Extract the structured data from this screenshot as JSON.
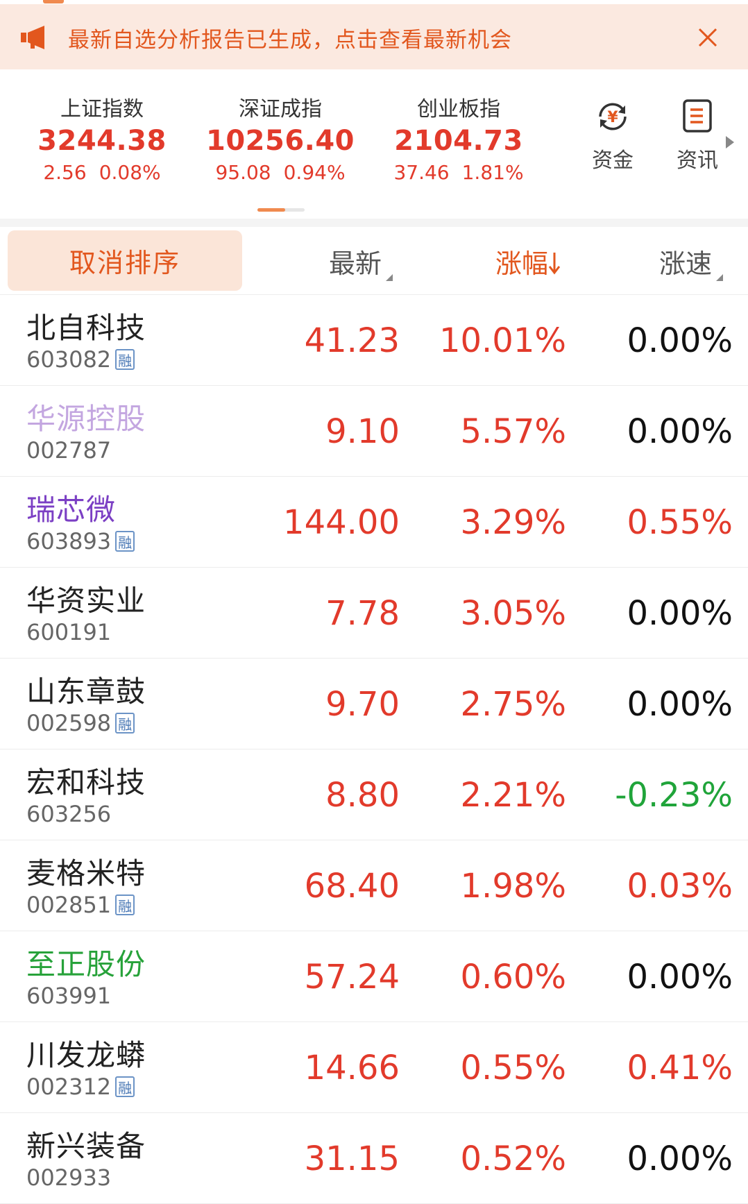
{
  "banner": {
    "message": "最新自选分析报告已生成，点击查看最新机会",
    "accent": "#e2571e",
    "icon": "megaphone-icon",
    "close_icon": "close-icon"
  },
  "indices": [
    {
      "name": "上证指数",
      "value": "3244.38",
      "change": "2.56",
      "pct": "0.08%"
    },
    {
      "name": "深证成指",
      "value": "10256.40",
      "change": "95.08",
      "pct": "0.94%"
    },
    {
      "name": "创业板指",
      "value": "2104.73",
      "change": "37.46",
      "pct": "1.81%"
    }
  ],
  "quick_actions": [
    {
      "label": "资金",
      "icon": "yuan-cycle-icon"
    },
    {
      "label": "资讯",
      "icon": "news-document-icon"
    }
  ],
  "table_header": {
    "cancel_sort": "取消排序",
    "latest": "最新",
    "change_pct": "涨幅",
    "speed": "涨速",
    "sort_indicator": "arrow-down-icon"
  },
  "colors": {
    "up": "#e23a2b",
    "down": "#20a43a",
    "flat": "#111111"
  },
  "rows": [
    {
      "name": "北自科技",
      "name_color": "#222222",
      "code": "603082",
      "margin": true,
      "margin_label": "融",
      "latest": "41.23",
      "change": "10.01%",
      "speed": "0.00%",
      "speed_dir": "flat"
    },
    {
      "name": "华源控股",
      "name_color": "#c3a6e0",
      "code": "002787",
      "margin": false,
      "margin_label": "",
      "latest": "9.10",
      "change": "5.57%",
      "speed": "0.00%",
      "speed_dir": "flat"
    },
    {
      "name": "瑞芯微",
      "name_color": "#7b3fc4",
      "code": "603893",
      "margin": true,
      "margin_label": "融",
      "latest": "144.00",
      "change": "3.29%",
      "speed": "0.55%",
      "speed_dir": "up"
    },
    {
      "name": "华资实业",
      "name_color": "#222222",
      "code": "600191",
      "margin": false,
      "margin_label": "",
      "latest": "7.78",
      "change": "3.05%",
      "speed": "0.00%",
      "speed_dir": "flat"
    },
    {
      "name": "山东章鼓",
      "name_color": "#222222",
      "code": "002598",
      "margin": true,
      "margin_label": "融",
      "latest": "9.70",
      "change": "2.75%",
      "speed": "0.00%",
      "speed_dir": "flat"
    },
    {
      "name": "宏和科技",
      "name_color": "#222222",
      "code": "603256",
      "margin": false,
      "margin_label": "",
      "latest": "8.80",
      "change": "2.21%",
      "speed": "-0.23%",
      "speed_dir": "down"
    },
    {
      "name": "麦格米特",
      "name_color": "#222222",
      "code": "002851",
      "margin": true,
      "margin_label": "融",
      "latest": "68.40",
      "change": "1.98%",
      "speed": "0.03%",
      "speed_dir": "up"
    },
    {
      "name": "至正股份",
      "name_color": "#27a23a",
      "code": "603991",
      "margin": false,
      "margin_label": "",
      "latest": "57.24",
      "change": "0.60%",
      "speed": "0.00%",
      "speed_dir": "flat"
    },
    {
      "name": "川发龙蟒",
      "name_color": "#222222",
      "code": "002312",
      "margin": true,
      "margin_label": "融",
      "latest": "14.66",
      "change": "0.55%",
      "speed": "0.41%",
      "speed_dir": "up"
    },
    {
      "name": "新兴装备",
      "name_color": "#222222",
      "code": "002933",
      "margin": false,
      "margin_label": "",
      "latest": "31.15",
      "change": "0.52%",
      "speed": "0.00%",
      "speed_dir": "flat"
    }
  ]
}
